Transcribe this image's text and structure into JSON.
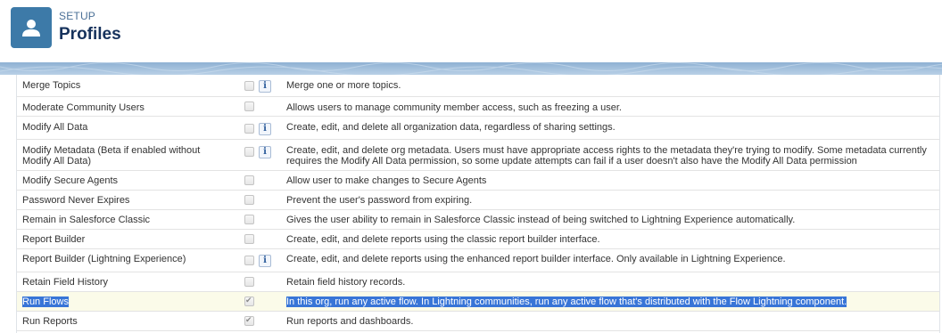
{
  "header": {
    "section": "SETUP",
    "title": "Profiles",
    "icon": "user-icon",
    "icon_color": "#3d7aa8"
  },
  "permissions": [
    {
      "name": "Merge Topics",
      "desc": "Merge one or more topics.",
      "checked": false,
      "info": true
    },
    {
      "name": "Moderate Community Users",
      "desc": "Allows users to manage community member access, such as freezing a user.",
      "checked": false,
      "info": false
    },
    {
      "name": "Modify All Data",
      "desc": "Create, edit, and delete all organization data, regardless of sharing settings.",
      "checked": false,
      "info": true
    },
    {
      "name": "Modify Metadata (Beta if enabled without Modify All Data)",
      "desc": "Create, edit, and delete org metadata. Users must have appropriate access rights to the metadata they're trying to modify. Some metadata currently requires the Modify All Data permission, so some update attempts can fail if a user doesn't also have the Modify All Data permission",
      "checked": false,
      "info": true
    },
    {
      "name": "Modify Secure Agents",
      "desc": "Allow user to make changes to Secure Agents",
      "checked": false,
      "info": false
    },
    {
      "name": "Password Never Expires",
      "desc": "Prevent the user's password from expiring.",
      "checked": false,
      "info": false
    },
    {
      "name": "Remain in Salesforce Classic",
      "desc": "Gives the user ability to remain in Salesforce Classic instead of being switched to Lightning Experience automatically.",
      "checked": false,
      "info": false
    },
    {
      "name": "Report Builder",
      "desc": "Create, edit, and delete reports using the classic report builder interface.",
      "checked": false,
      "info": false
    },
    {
      "name": "Report Builder (Lightning Experience)",
      "desc": "Create, edit, and delete reports using the enhanced report builder interface. Only available in Lightning Experience.",
      "checked": false,
      "info": true
    },
    {
      "name": "Retain Field History",
      "desc": "Retain field history records.",
      "checked": false,
      "info": false
    },
    {
      "name": "Run Flows",
      "desc": "In this org, run any active flow. In Lightning communities, run any active flow that's distributed with the Flow Lightning component.",
      "checked": true,
      "info": false,
      "selected": true
    },
    {
      "name": "Run Reports",
      "desc": "Run reports and dashboards.",
      "checked": true,
      "info": false
    }
  ]
}
